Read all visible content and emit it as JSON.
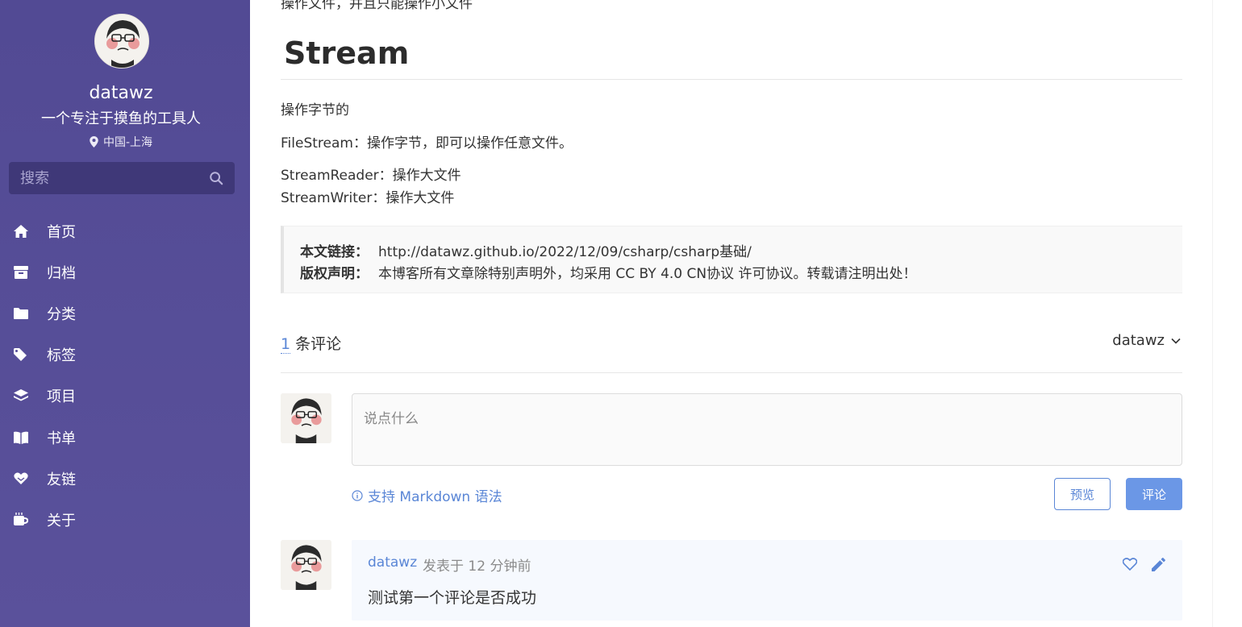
{
  "sidebar": {
    "site_name": "datawz",
    "subtitle": "一个专注于摸鱼的工具人",
    "location": "中国-上海",
    "search_placeholder": "搜索",
    "items": [
      {
        "label": "首页",
        "icon": "home-icon"
      },
      {
        "label": "归档",
        "icon": "archive-icon"
      },
      {
        "label": "分类",
        "icon": "folder-icon"
      },
      {
        "label": "标签",
        "icon": "tags-icon"
      },
      {
        "label": "项目",
        "icon": "layers-icon"
      },
      {
        "label": "书单",
        "icon": "book-icon"
      },
      {
        "label": "友链",
        "icon": "heart-hands-icon"
      },
      {
        "label": "关于",
        "icon": "coffee-icon"
      }
    ]
  },
  "article": {
    "top_cut_text": "操作文件，并且只能操作小文件",
    "heading": "Stream",
    "p1": "操作字节的",
    "p2": "FileStream：操作字节，即可以操作任意文件。",
    "p3": "StreamReader：操作大文件",
    "p4": "StreamWriter：操作大文件",
    "copyright": {
      "link_label": "本文链接：",
      "link_value": "http://datawz.github.io/2022/12/09/csharp/csharp基础/",
      "license_label": "版权声明：",
      "license_value": "本博客所有文章除特别声明外，均采用 CC BY 4.0 CN协议 许可协议。转载请注明出处！"
    }
  },
  "comments": {
    "count": "1",
    "count_suffix": "条评论",
    "user": "datawz",
    "input_placeholder": "说点什么",
    "markdown_hint": "支持 Markdown 语法",
    "preview_label": "预览",
    "submit_label": "评论",
    "list": [
      {
        "author": "datawz",
        "meta": "发表于  12 分钟前",
        "text": "测试第一个评论是否成功"
      }
    ]
  },
  "colors": {
    "sidebar": "#524a94",
    "accent": "#5a86d6",
    "button": "#6b97e6"
  }
}
